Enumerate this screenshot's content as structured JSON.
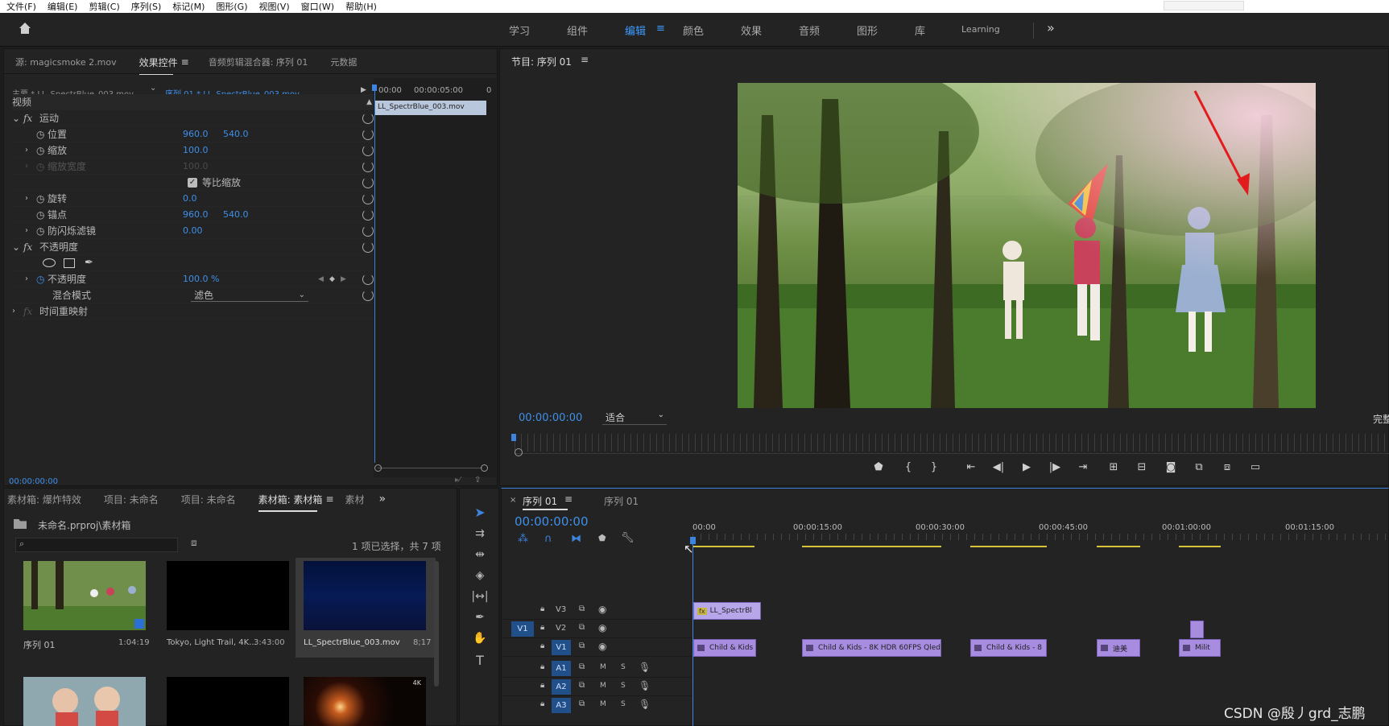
{
  "menu": [
    "文件(F)",
    "编辑(E)",
    "剪辑(C)",
    "序列(S)",
    "标记(M)",
    "图形(G)",
    "视图(V)",
    "窗口(W)",
    "帮助(H)"
  ],
  "workspaces": [
    "学习",
    "组件",
    "编辑",
    "颜色",
    "效果",
    "音频",
    "图形",
    "库",
    "Learning"
  ],
  "source_panel": {
    "tabs": [
      "源: magicsmoke 2.mov",
      "效果控件",
      "音频剪辑混合器: 序列 01",
      "元数据"
    ],
    "master": "主要 * LL_SpectrBlue_003.mov",
    "sequence_clip": "序列 01 * LL_SpectrBlue_003.mov",
    "tc_start": "00:00",
    "tc_mid": "00:00:05:00",
    "tc_end": "0",
    "clip_label": "LL_SpectrBlue_003.mov",
    "video_header": "视频",
    "motion": "运动",
    "position_label": "位置",
    "position_x": "960.0",
    "position_y": "540.0",
    "scale_label": "缩放",
    "scale_val": "100.0",
    "scale_width_label": "缩放宽度",
    "scale_width_val": "100.0",
    "uniform_label": "等比缩放",
    "rotation_label": "旋转",
    "rotation_val": "0.0",
    "anchor_label": "锚点",
    "anchor_x": "960.0",
    "anchor_y": "540.0",
    "flicker_label": "防闪烁滤镜",
    "flicker_val": "0.00",
    "opacity_header": "不透明度",
    "opacity_label": "不透明度",
    "opacity_val": "100.0 %",
    "blend_label": "混合模式",
    "blend_val": "滤色",
    "time_remap": "时间重映射",
    "timecode": "00:00:00:00"
  },
  "program": {
    "title": "节目: 序列 01",
    "timecode": "00:00:00:00",
    "fit": "适合",
    "quality": "完整"
  },
  "project": {
    "tabs": [
      "素材箱: 爆炸特效",
      "项目: 未命名",
      "项目: 未命名",
      "素材箱: 素材箱",
      "素材"
    ],
    "path": "未命名.prproj\\素材箱",
    "selection": "1 项已选择，共 7 项",
    "items": [
      {
        "name": "序列 01",
        "duration": "1:04:19"
      },
      {
        "name": "Tokyo, Light Trail, 4K...",
        "duration": "3:43:00"
      },
      {
        "name": "LL_SpectrBlue_003.mov",
        "duration": "8;17"
      }
    ],
    "badge_4k": "4K"
  },
  "timeline": {
    "tabs": [
      "序列 01",
      "序列 01"
    ],
    "timecode": "00:00:00:00",
    "ruler": [
      "00:00",
      "00:00:15:00",
      "00:00:30:00",
      "00:00:45:00",
      "00:01:00:00",
      "00:01:15:00"
    ],
    "tracks_video": [
      "V3",
      "V2",
      "V1"
    ],
    "source_patch": "V1",
    "tracks_audio": [
      "A1",
      "A2",
      "A3"
    ],
    "m": "M",
    "s": "S",
    "clips": {
      "v3": "LL_SpectrBl",
      "v1a": "Child & Kids",
      "v1b": "Child & Kids - 8K HDR 60FPS Qled",
      "v1c": "Child & Kids - 8",
      "v1d": "迪美",
      "v1e": "Milit"
    }
  },
  "watermark": "CSDN @殷丿grd_志鹏"
}
